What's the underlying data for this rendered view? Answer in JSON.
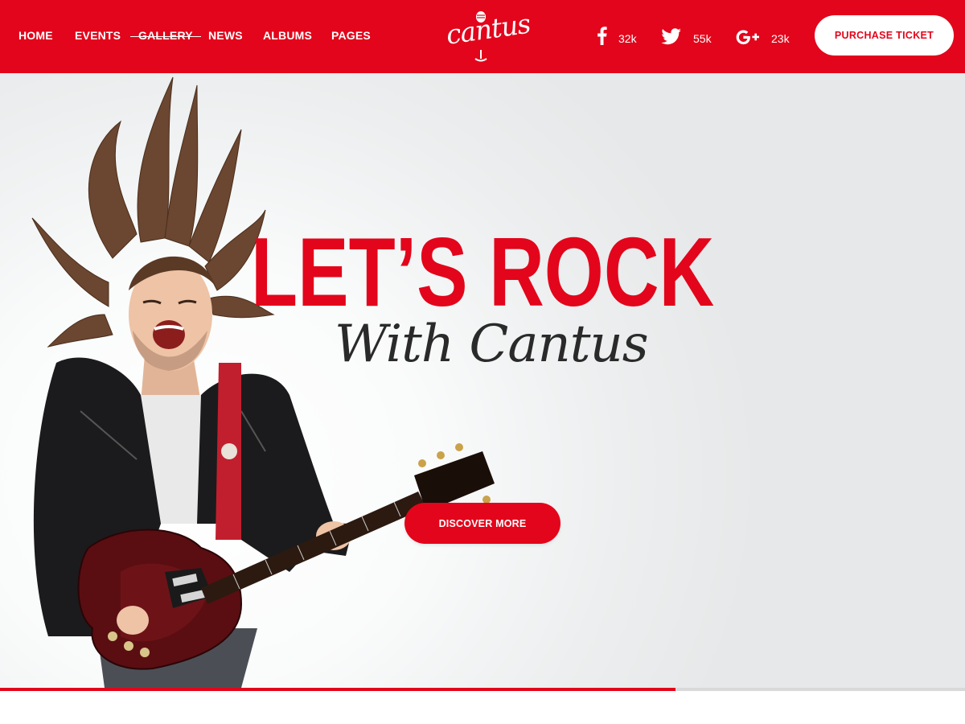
{
  "header": {
    "nav": [
      {
        "label": "HOME"
      },
      {
        "label": "EVENTS"
      },
      {
        "label": "GALLERY"
      },
      {
        "label": "NEWS"
      },
      {
        "label": "ALBUMS"
      },
      {
        "label": "PAGES"
      }
    ],
    "logo_text": "cantus",
    "social": [
      {
        "icon": "facebook-icon",
        "count": "32k"
      },
      {
        "icon": "twitter-icon",
        "count": "55k"
      },
      {
        "icon": "google-plus-icon",
        "count": "23k"
      }
    ],
    "ticket_button": "PURCHASE TICKET"
  },
  "hero": {
    "headline": "LET’S ROCK",
    "subline": "With Cantus",
    "cta_button": "DISCOVER MORE",
    "slider_progress_percent": 70
  },
  "colors": {
    "brand_red": "#e3051b",
    "text_dark": "#2a2a2a",
    "white": "#ffffff"
  }
}
